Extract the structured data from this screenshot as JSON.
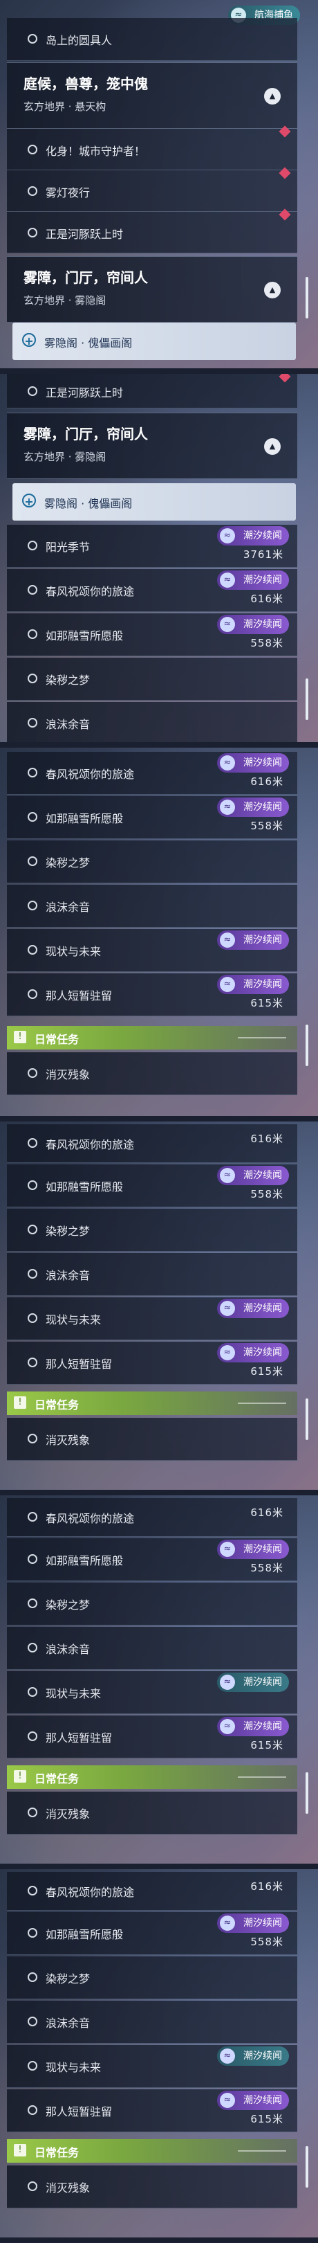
{
  "app": {
    "top_badge": "航海捕鱼",
    "badge_label": "潮汐续闻",
    "daily_label": "日常任务",
    "select_icon": "plus-circle-icon",
    "badge_icon": "wave-icon"
  },
  "sections": [
    {
      "key": "s1",
      "items": {
        "r0": "岛上的圆具人",
        "h1_title": "庭候，兽尊，笼中傀",
        "h1_sub": "玄方地界 · 悬天构",
        "r1": "化身！城市守护者！",
        "r2": "雾灯夜行",
        "r3": "正是河豚跃上时",
        "h2_title": "雾障，门厅，帘间人",
        "h2_sub": "玄方地界 · 雾隐阁",
        "sel": "雾隐阁 · 傀儡画阁"
      }
    },
    {
      "key": "s2",
      "items": {
        "r0": "正是河豚跃上时",
        "h_title": "雾障，门厅，帘间人",
        "h_sub": "玄方地界 · 雾隐阁",
        "sel": "雾隐阁 · 傀儡画阁",
        "r1": "阳光季节",
        "r1d": "3761米",
        "r2": "春风祝颂你的旅途",
        "r2d": "616米",
        "r3": "如那融雪所愿般",
        "r3d": "558米",
        "r4": "染秽之梦",
        "r5": "浪沫余音"
      }
    },
    {
      "key": "s3",
      "items": {
        "r1": "春风祝颂你的旅途",
        "r1d": "616米",
        "r2": "如那融雪所愿般",
        "r2d": "558米",
        "r3": "染秽之梦",
        "r4": "浪沫余音",
        "r5": "现状与未来",
        "r6": "那人短暂驻留",
        "r6d": "615米",
        "r7": "消灭残象"
      }
    },
    {
      "key": "s4",
      "items": {
        "r1": "春风祝颂你的旅途",
        "r1d": "616米",
        "r2": "如那融雪所愿般",
        "r2d": "558米",
        "r3": "染秽之梦",
        "r4": "浪沫余音",
        "r5": "现状与未来",
        "r6": "那人短暂驻留",
        "r6d": "615米",
        "r7": "消灭残象"
      }
    },
    {
      "key": "s5",
      "items": {
        "r1": "春风祝颂你的旅途",
        "r1d": "616米",
        "r2": "如那融雪所愿般",
        "r2d": "558米",
        "r3": "染秽之梦",
        "r4": "浪沫余音",
        "r5": "现状与未来",
        "r6": "那人短暂驻留",
        "r6d": "615米",
        "r7": "消灭残象"
      }
    },
    {
      "key": "s6",
      "items": {
        "r1": "春风祝颂你的旅途",
        "r1d": "616米",
        "r2": "如那融雪所愿般",
        "r2d": "558米",
        "r3": "染秽之梦",
        "r4": "浪沫余音",
        "r5": "现状与未来",
        "r6": "那人短暂驻留",
        "r6d": "615米",
        "r7": "消灭残象"
      }
    }
  ]
}
